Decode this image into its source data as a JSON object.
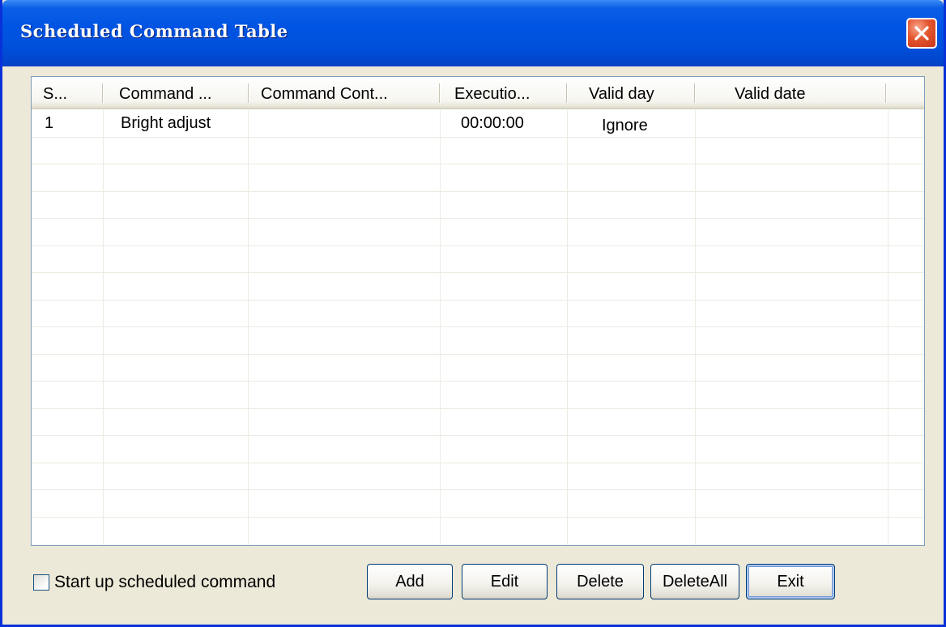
{
  "window": {
    "title": "Scheduled Command Table"
  },
  "table": {
    "columns": [
      "S...",
      "Command ...",
      "Command Cont...",
      "Executio...",
      "Valid day",
      "Valid date"
    ],
    "rows": [
      {
        "serial": "1",
        "command": "Bright adjust",
        "content": "",
        "execution": "00:00:00",
        "valid_day": "Ignore",
        "valid_date": ""
      }
    ]
  },
  "options": {
    "startup_label": "Start up scheduled command",
    "startup_checked": false
  },
  "buttons": {
    "add": "Add",
    "edit": "Edit",
    "delete": "Delete",
    "delete_all": "DeleteAll",
    "exit": "Exit"
  },
  "colors": {
    "titlebar": "#0054e3",
    "close": "#e2552e",
    "face": "#ece9d8"
  },
  "icons": {
    "close": "close-icon"
  }
}
